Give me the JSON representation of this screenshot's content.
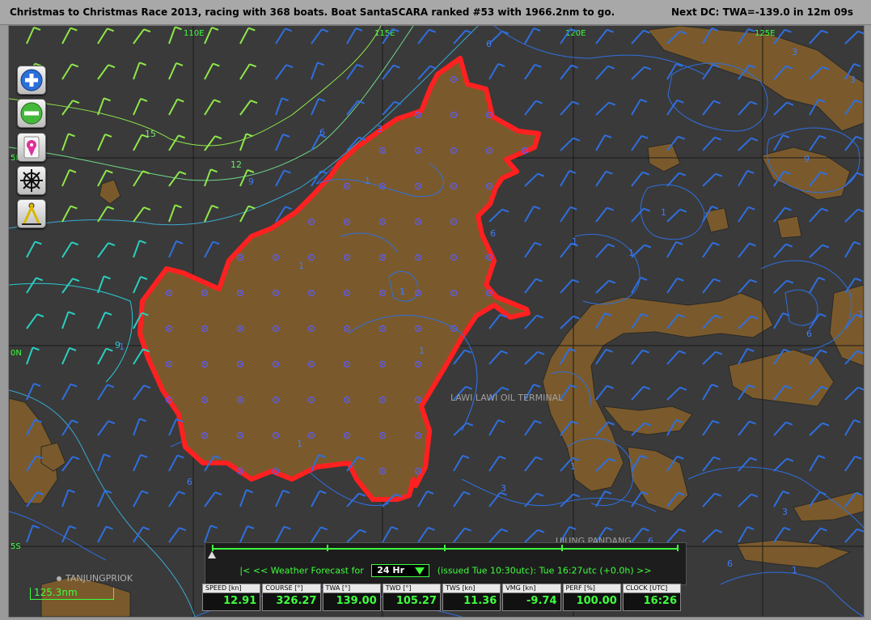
{
  "titlebar": {
    "race_info": "Christmas to Christmas Race 2013, racing with 368 boats. Boat SantaSCARA ranked #53 with 1966.2nm to go.",
    "next_dc": "Next DC: TWA=-139.0 in 12m 09s"
  },
  "map": {
    "lon_labels": [
      "110E",
      "115E",
      "120E",
      "125E"
    ],
    "lat_labels": [
      "5N",
      "0N",
      "5S"
    ],
    "isobar_labels_blue": [
      "6",
      "9",
      "3",
      "6",
      "1",
      "6",
      "1",
      "1",
      "1",
      "1",
      "6",
      "3",
      "1",
      "6",
      "3",
      "1",
      "1",
      "6",
      "3",
      "9",
      "6",
      "1",
      "3",
      "1",
      "1",
      "6",
      "1"
    ],
    "isobar_labels_green": [
      "15",
      "12"
    ],
    "isobar_label_cyan": "9",
    "place_labels": [
      "LAWI LAWI OIL TERMINAL",
      "UJUNG PANDANG",
      "TANJUNGPRIOK"
    ],
    "scale": "125.3nm",
    "colors": {
      "sea": "#3a3a3a",
      "land": "#7a5a2c",
      "zone_border": "#ff2020",
      "wind_blue": "#2f6fe0",
      "wind_green": "#8ee84a",
      "wind_cyan": "#2ad0c0"
    }
  },
  "toolbar": [
    {
      "icon": "zoom-in-icon"
    },
    {
      "icon": "zoom-out-icon"
    },
    {
      "icon": "boat-locate-icon"
    },
    {
      "icon": "helm-wheel-icon"
    },
    {
      "icon": "compass-divider-icon"
    }
  ],
  "forecast": {
    "nav_back": "|< <<",
    "label": "Weather Forecast for",
    "selected": "24 Hr",
    "issued": "(issued Tue 10:30utc): Tue 16:27utc  (+0.0h)",
    "nav_forward": ">>"
  },
  "instruments": [
    {
      "name": "SPEED [kn]",
      "value": "12.91"
    },
    {
      "name": "COURSE [°]",
      "value": "326.27"
    },
    {
      "name": "TWA [°]",
      "value": "139.00"
    },
    {
      "name": "TWD [°]",
      "value": "105.27"
    },
    {
      "name": "TWS [kn]",
      "value": "11.36"
    },
    {
      "name": "VMG [kn]",
      "value": "-9.74"
    },
    {
      "name": "PERF [%]",
      "value": "100.00"
    },
    {
      "name": "CLOCK [UTC]",
      "value": "16:26"
    }
  ]
}
